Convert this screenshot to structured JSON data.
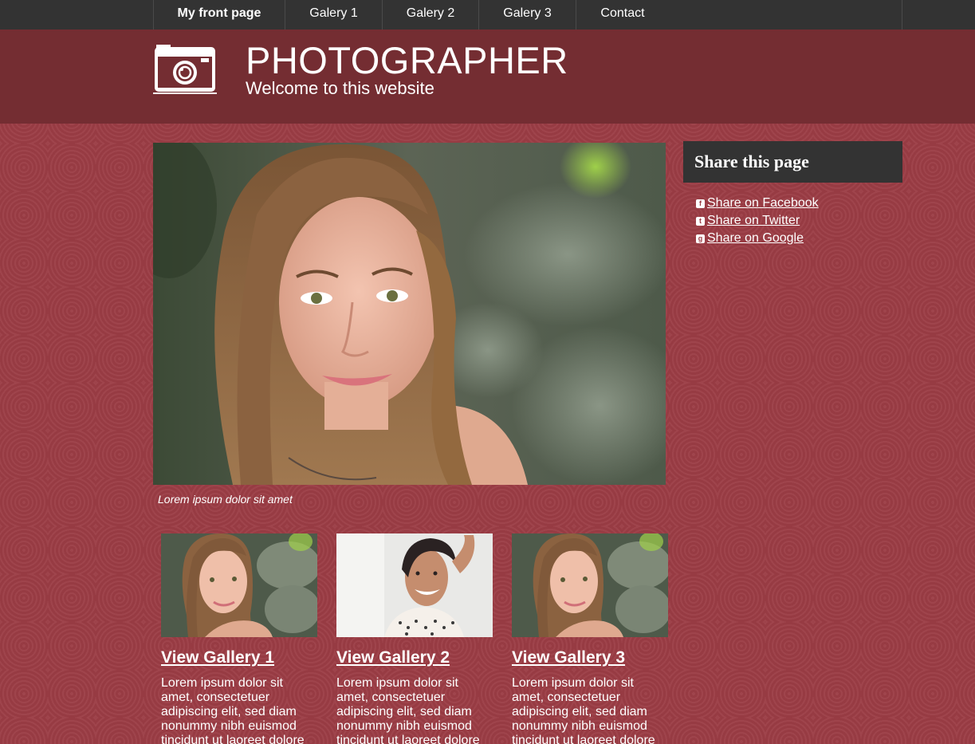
{
  "nav": {
    "items": [
      {
        "label": "My front page",
        "active": true
      },
      {
        "label": "Galery 1",
        "active": false
      },
      {
        "label": "Galery 2",
        "active": false
      },
      {
        "label": "Galery 3",
        "active": false
      },
      {
        "label": "Contact",
        "active": false
      }
    ]
  },
  "header": {
    "logo_icon": "camera-icon",
    "title": "PHOTOGRAPHER",
    "subtitle": "Welcome to this website"
  },
  "hero": {
    "image": "portrait-photo-girl",
    "caption": "Lorem ipsum dolor sit amet"
  },
  "sidebar": {
    "title": "Share this page",
    "links": [
      {
        "icon": "facebook-icon",
        "label": "Share on Facebook"
      },
      {
        "icon": "twitter-icon",
        "label": "Share on Twitter"
      },
      {
        "icon": "google-icon",
        "label": "Share on Google"
      }
    ]
  },
  "galleries": [
    {
      "thumb": "portrait-photo-girl",
      "title": "View Gallery 1",
      "text": "Lorem ipsum dolor sit amet, consectetuer adipiscing elit, sed diam nonummy nibh euismod tincidunt ut laoreet dolore"
    },
    {
      "thumb": "portrait-photo-woman",
      "title": "View Gallery 2",
      "text": "Lorem ipsum dolor sit amet, consectetuer adipiscing elit, sed diam nonummy nibh euismod tincidunt ut laoreet dolore"
    },
    {
      "thumb": "portrait-photo-girl",
      "title": "View Gallery 3",
      "text": "Lorem ipsum dolor sit amet, consectetuer adipiscing elit, sed diam nonummy nibh euismod tincidunt ut laoreet dolore"
    }
  ],
  "colors": {
    "nav_bg": "#333333",
    "header_bg": "#742d32",
    "page_bg": "#9c3d45",
    "text": "#ffffff"
  }
}
